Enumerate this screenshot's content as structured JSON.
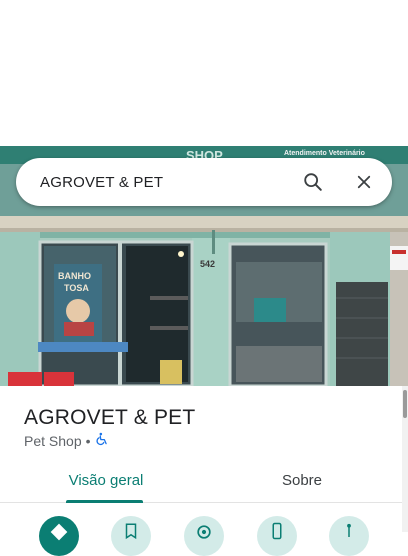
{
  "search": {
    "query": "AGROVET & PET"
  },
  "photo": {
    "sign_text": "SHOP",
    "sign_subtext": "Atendimento Veterinário",
    "poster_line1": "BANHO",
    "poster_line2": "TOSA",
    "house_number": "542"
  },
  "place": {
    "name": "AGROVET & PET",
    "category": "Pet Shop",
    "separator": "•"
  },
  "tabs": [
    {
      "label": "Visão geral",
      "active": true
    },
    {
      "label": "Sobre",
      "active": false
    }
  ],
  "actions": [
    {
      "icon": "directions-icon"
    },
    {
      "icon": "save-icon"
    },
    {
      "icon": "nearby-icon"
    },
    {
      "icon": "phone-icon"
    },
    {
      "icon": "share-icon"
    }
  ],
  "colors": {
    "accent": "#0b7e73",
    "accent_light": "#d3ebe8",
    "text": "#202124",
    "muted": "#5f6368"
  }
}
